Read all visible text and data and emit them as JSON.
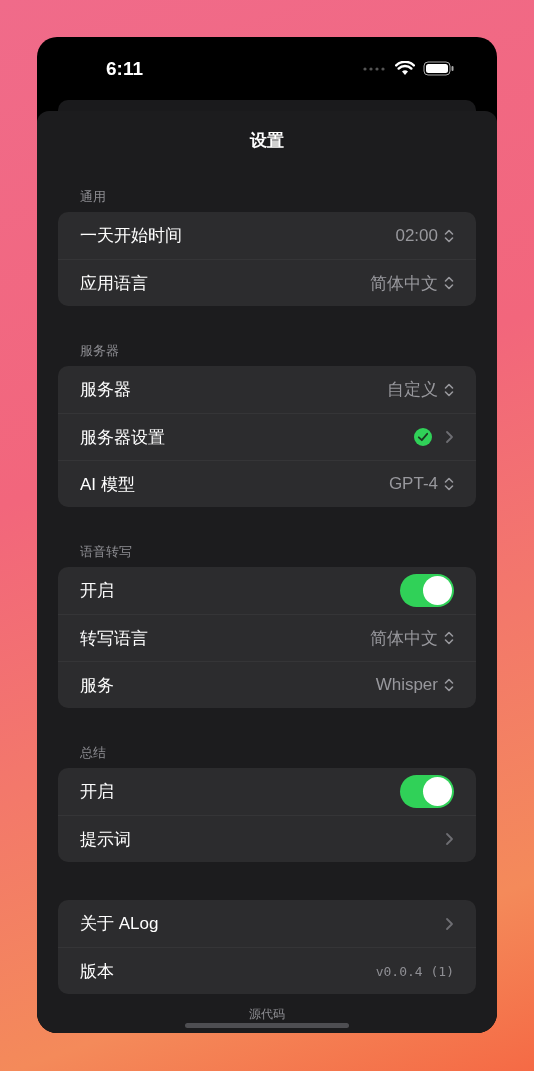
{
  "status_bar": {
    "time": "6:11"
  },
  "sheet": {
    "title": "设置"
  },
  "sections": [
    {
      "header": "通用",
      "rows": [
        {
          "kind": "picker",
          "label": "一天开始时间",
          "value": "02:00"
        },
        {
          "kind": "picker",
          "label": "应用语言",
          "value": "简体中文"
        }
      ]
    },
    {
      "header": "服务器",
      "rows": [
        {
          "kind": "picker",
          "label": "服务器",
          "value": "自定义"
        },
        {
          "kind": "link",
          "label": "服务器设置",
          "verified": true
        },
        {
          "kind": "picker",
          "label": "AI 模型",
          "value": "GPT-4"
        }
      ]
    },
    {
      "header": "语音转写",
      "rows": [
        {
          "kind": "toggle",
          "label": "开启",
          "on": true
        },
        {
          "kind": "picker",
          "label": "转写语言",
          "value": "简体中文"
        },
        {
          "kind": "picker",
          "label": "服务",
          "value": "Whisper"
        }
      ]
    },
    {
      "header": "总结",
      "rows": [
        {
          "kind": "toggle",
          "label": "开启",
          "on": true
        },
        {
          "kind": "link",
          "label": "提示词",
          "verified": false
        }
      ]
    },
    {
      "rows": [
        {
          "kind": "link",
          "label": "关于 ALog",
          "verified": false
        },
        {
          "kind": "info",
          "label": "版本",
          "value": "v0.0.4 (1)"
        }
      ]
    }
  ],
  "footer_link": "源代码"
}
